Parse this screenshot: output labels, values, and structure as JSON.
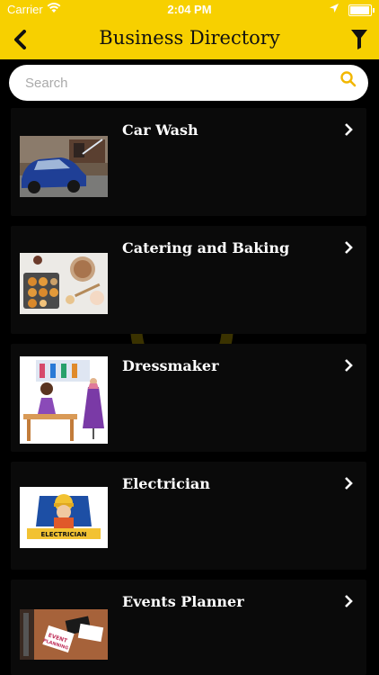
{
  "status_bar": {
    "carrier": "Carrier",
    "time": "2:04 PM",
    "battery_level": 0.95
  },
  "nav": {
    "title": "Business Directory",
    "back_icon": "chevron-left-icon",
    "filter_icon": "filter-icon"
  },
  "search": {
    "placeholder": "Search",
    "value": ""
  },
  "watermark": {
    "text": "OutOBox"
  },
  "colors": {
    "accent": "#f7d000",
    "background": "#000000",
    "card": "#0a0a0a",
    "text": "#ffffff"
  },
  "items": [
    {
      "name": "Car Wash",
      "image": "car-wash-photo"
    },
    {
      "name": "Catering and Baking",
      "image": "baking-photo"
    },
    {
      "name": "Dressmaker",
      "image": "dressmaker-illustration"
    },
    {
      "name": "Electrician",
      "image": "electrician-illustration"
    },
    {
      "name": "Events Planner",
      "image": "events-planner-photo"
    }
  ]
}
